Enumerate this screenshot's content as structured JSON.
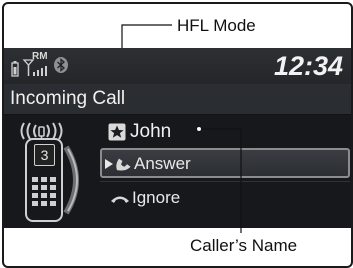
{
  "callouts": {
    "mode_label": "HFL Mode",
    "name_label": "Caller’s Name"
  },
  "status": {
    "carrier_badge": "RM",
    "clock": "12:34",
    "battery_icon": "battery-icon",
    "signal_icon": "signal-strength-icon",
    "bluetooth_icon": "bluetooth-icon"
  },
  "call": {
    "title": "Incoming Call",
    "caller_name": "John",
    "speed_dial": "3",
    "ringing_icon": "ringing-waves-icon",
    "contact_icon": "star-contact-icon"
  },
  "actions": [
    {
      "label": "Answer",
      "icon": "answer-call-icon",
      "selected": true
    },
    {
      "label": "Ignore",
      "icon": "hang-up-icon",
      "selected": false
    }
  ],
  "colors": {
    "screen_bg": "#1b1d20",
    "selection_border": "#8a8d90",
    "text": "#e6e6e6"
  }
}
